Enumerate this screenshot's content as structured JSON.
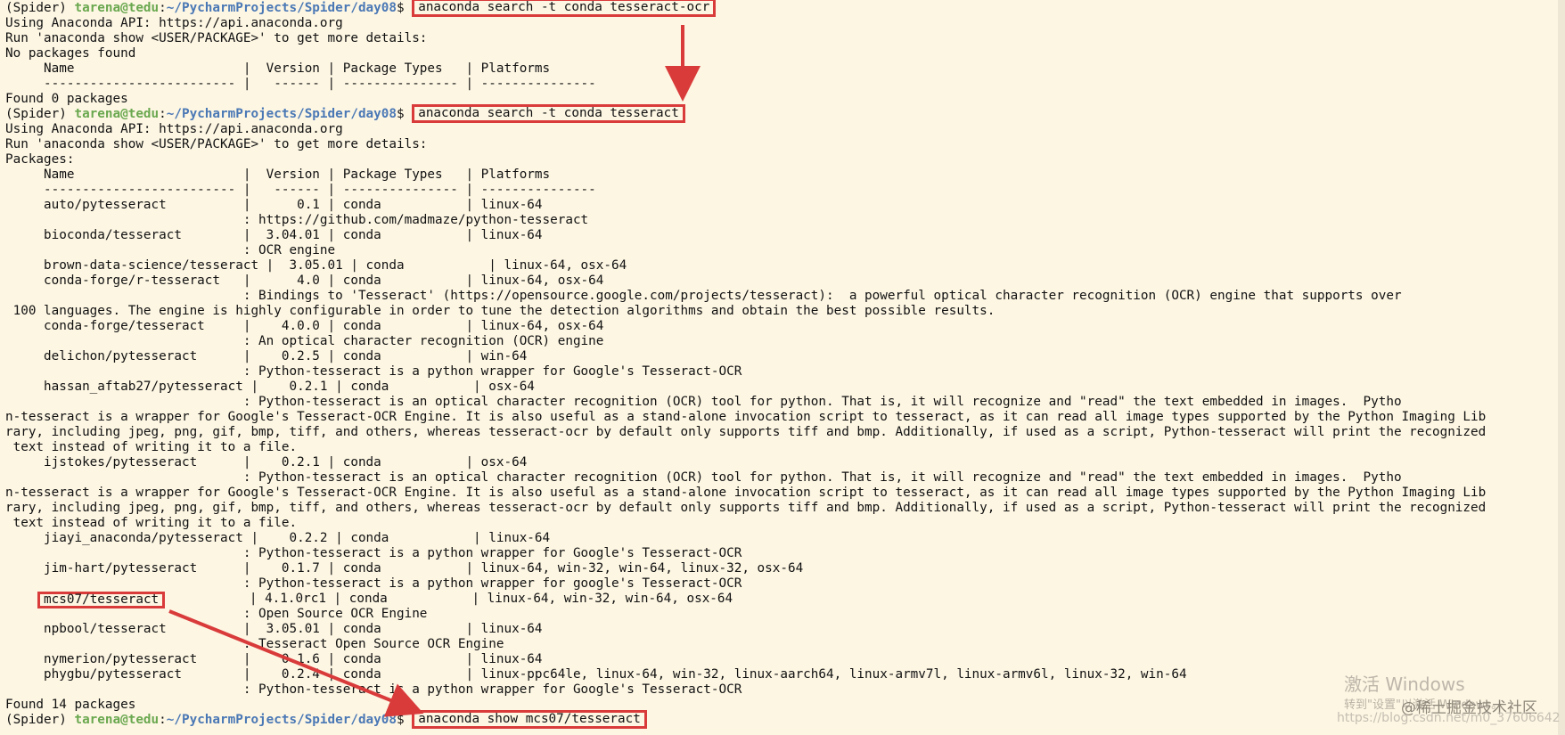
{
  "prompt": {
    "env": "(Spider) ",
    "user_host": "tarena@tedu",
    "colon": ":",
    "path": "~/PycharmProjects/Spider/day08",
    "dollar": "$ "
  },
  "commands": {
    "c1": "anaconda search -t conda tesseract-ocr",
    "c2": "anaconda search -t conda tesseract",
    "c3": "anaconda show mcs07/tesseract"
  },
  "lines": {
    "l2": "Using Anaconda API: https://api.anaconda.org",
    "l3": "Run 'anaconda show <USER/PACKAGE>' to get more details:",
    "l4": "No packages found",
    "l5": "     Name                      |  Version | Package Types   | Platforms",
    "l6": "     ------------------------- |   ------ | --------------- | ---------------",
    "l7": "Found 0 packages",
    "l9": "Using Anaconda API: https://api.anaconda.org",
    "l10": "Run 'anaconda show <USER/PACKAGE>' to get more details:",
    "l11": "Packages:",
    "l12": "     Name                      |  Version | Package Types   | Platforms",
    "l13": "     ------------------------- |   ------ | --------------- | ---------------",
    "l14": "     auto/pytesseract          |      0.1 | conda           | linux-64",
    "l15": "                               : https://github.com/madmaze/python-tesseract",
    "l16": "     bioconda/tesseract        |  3.04.01 | conda           | linux-64",
    "l17": "                               : OCR engine",
    "l18": "     brown-data-science/tesseract |  3.05.01 | conda           | linux-64, osx-64",
    "l19": "     conda-forge/r-tesseract   |      4.0 | conda           | linux-64, osx-64",
    "l20": "                               : Bindings to 'Tesseract' (https://opensource.google.com/projects/tesseract):  a powerful optical character recognition (OCR) engine that supports over",
    "l21": " 100 languages. The engine is highly configurable in order to tune the detection algorithms and obtain the best possible results.",
    "l22": "     conda-forge/tesseract     |    4.0.0 | conda           | linux-64, osx-64",
    "l23": "                               : An optical character recognition (OCR) engine",
    "l24": "     delichon/pytesseract      |    0.2.5 | conda           | win-64",
    "l25": "                               : Python-tesseract is a python wrapper for Google's Tesseract-OCR",
    "l26": "     hassan_aftab27/pytesseract |    0.2.1 | conda           | osx-64",
    "l27": "                               : Python-tesseract is an optical character recognition (OCR) tool for python. That is, it will recognize and \"read\" the text embedded in images.  Pytho",
    "l28": "n-tesseract is a wrapper for Google's Tesseract-OCR Engine. It is also useful as a stand-alone invocation script to tesseract, as it can read all image types supported by the Python Imaging Lib",
    "l29": "rary, including jpeg, png, gif, bmp, tiff, and others, whereas tesseract-ocr by default only supports tiff and bmp. Additionally, if used as a script, Python-tesseract will print the recognized",
    "l30": " text instead of writing it to a file.",
    "l31": "     ijstokes/pytesseract      |    0.2.1 | conda           | osx-64",
    "l32": "                               : Python-tesseract is an optical character recognition (OCR) tool for python. That is, it will recognize and \"read\" the text embedded in images.  Pytho",
    "l33": "n-tesseract is a wrapper for Google's Tesseract-OCR Engine. It is also useful as a stand-alone invocation script to tesseract, as it can read all image types supported by the Python Imaging Lib",
    "l34": "rary, including jpeg, png, gif, bmp, tiff, and others, whereas tesseract-ocr by default only supports tiff and bmp. Additionally, if used as a script, Python-tesseract will print the recognized",
    "l35": " text instead of writing it to a file.",
    "l36": "     jiayi_anaconda/pytesseract |    0.2.2 | conda           | linux-64",
    "l37": "                               : Python-tesseract is a python wrapper for Google's Tesseract-OCR",
    "l38": "     jim-hart/pytesseract      |    0.1.7 | conda           | linux-64, win-32, win-64, linux-32, osx-64",
    "l39": "                               : Python-tesseract is a python wrapper for google's Tesseract-OCR",
    "l40_indent": "     ",
    "l40_name": "mcs07/tesseract",
    "l40_rest": "           | 4.1.0rc1 | conda           | linux-64, win-32, win-64, osx-64",
    "l41": "                               : Open Source OCR Engine",
    "l42": "     npbool/tesseract          |  3.05.01 | conda           | linux-64",
    "l43": "                               : Tesseract Open Source OCR Engine",
    "l44": "     nymerion/pytesseract      |    0.1.6 | conda           | linux-64",
    "l45": "     phygbu/pytesseract        |    0.2.4 | conda           | linux-ppc64le, linux-64, win-32, linux-aarch64, linux-armv7l, linux-armv6l, linux-32, win-64",
    "l46": "                               : Python-tesseract is a python wrapper for Google's Tesseract-OCR",
    "l47": "Found 14 packages"
  },
  "watermark": {
    "activate": "激活 Windows",
    "settings": "转到\"设置\"以激活 Windows。",
    "community": "@稀土掘金技术社区",
    "url": "https://blog.csdn.net/m0_37606642"
  },
  "colors": {
    "background": "#fdf6e3",
    "text": "#111111",
    "user_host": "#6aa84f",
    "path": "#4a78b5",
    "highlight": "#d93b3b"
  }
}
